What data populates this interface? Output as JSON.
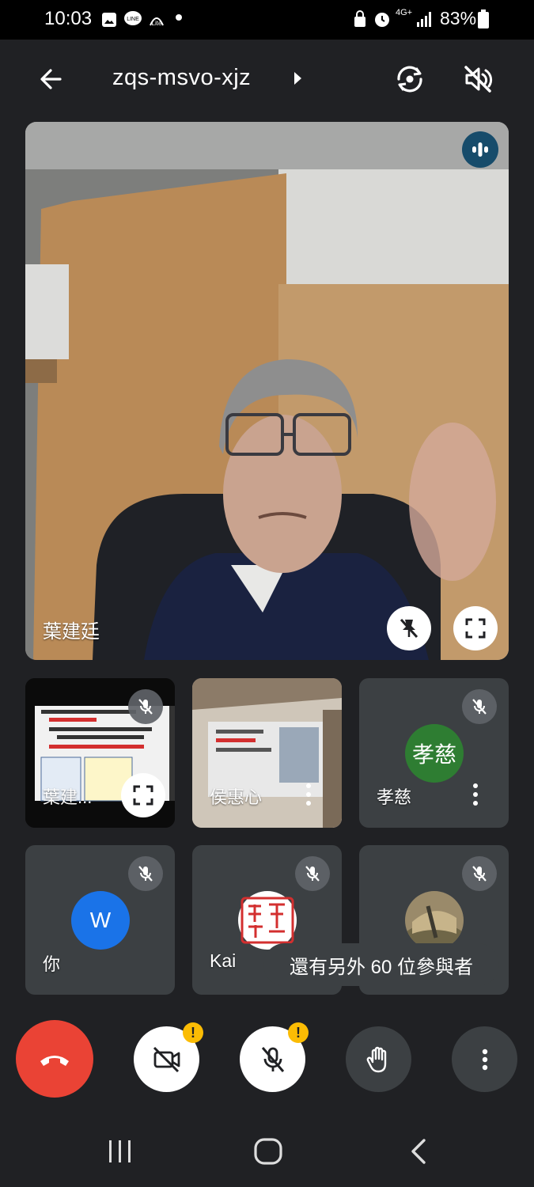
{
  "status_bar": {
    "time": "10:03",
    "battery": "83%",
    "network": "4G+",
    "icons": [
      "gallery-icon",
      "line-icon",
      "line-lite-icon",
      "dot-icon",
      "vpn-icon",
      "alarm-icon",
      "network-icon",
      "signal-icon",
      "battery-icon"
    ]
  },
  "header": {
    "meeting_code": "zqs-msvo-xjz",
    "icons": [
      "back-arrow-icon",
      "chevron-right-icon",
      "switch-camera-icon",
      "speaker-off-icon"
    ]
  },
  "main_speaker": {
    "name": "葉建廷"
  },
  "tiles": [
    {
      "name": "葉建...",
      "type": "screen-share",
      "muted": true
    },
    {
      "name": "侯惠心",
      "type": "video",
      "muted": false
    },
    {
      "name": "孝慈",
      "type": "avatar",
      "avatar_text": "孝慈",
      "avatar_color": "#2e7d32",
      "muted": true
    },
    {
      "name": "你",
      "type": "avatar",
      "avatar_text": "W",
      "avatar_color": "#1a73e8",
      "muted": true
    },
    {
      "name": "Kai",
      "type": "avatar-image",
      "muted": true
    },
    {
      "name": "",
      "type": "avatar-image",
      "muted": true
    }
  ],
  "toast": {
    "text": "還有另外 60 位參與者"
  },
  "colors": {
    "background": "#202124",
    "end_call": "#ea4335",
    "warning": "#fbbc04",
    "tile": "#3c4043"
  },
  "warning_mark": "!"
}
